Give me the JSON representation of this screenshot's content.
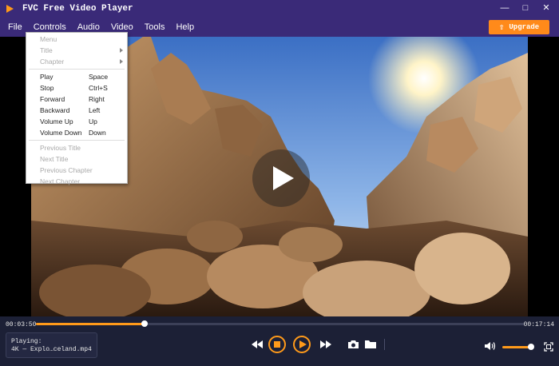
{
  "window": {
    "title": "FVC Free Video Player",
    "min_glyph": "—",
    "max_glyph": "□",
    "close_glyph": "✕"
  },
  "menubar": {
    "items": [
      "File",
      "Controls",
      "Audio",
      "Video",
      "Tools",
      "Help"
    ],
    "upgrade_label": "Upgrade"
  },
  "controls_menu": {
    "header": "Menu",
    "submenus": [
      "Title",
      "Chapter"
    ],
    "actions": [
      {
        "label": "Play",
        "shortcut": "Space"
      },
      {
        "label": "Stop",
        "shortcut": "Ctrl+S"
      },
      {
        "label": "Forward",
        "shortcut": "Right"
      },
      {
        "label": "Backward",
        "shortcut": "Left"
      },
      {
        "label": "Volume Up",
        "shortcut": "Up"
      },
      {
        "label": "Volume Down",
        "shortcut": "Down"
      }
    ],
    "navigation": [
      "Previous Title",
      "Next Title",
      "Previous Chapter",
      "Next Chapter"
    ]
  },
  "playback": {
    "current_time": "00:03:50",
    "total_time": "00:17:14",
    "progress_fraction": 0.222,
    "playing_label": "Playing:",
    "file_name": "4K — Explo…celand.mp4",
    "volume_fraction": 0.9
  },
  "colors": {
    "accent": "#ff9a1a",
    "titlebar": "#3a2a78",
    "panel": "#1c2036"
  },
  "icons": {
    "rewind": "rewind-icon",
    "stop": "stop-icon",
    "play": "play-icon",
    "forward": "fast-forward-icon",
    "snapshot": "camera-icon",
    "open": "folder-icon",
    "volume": "speaker-icon",
    "fullscreen": "fullscreen-icon"
  }
}
